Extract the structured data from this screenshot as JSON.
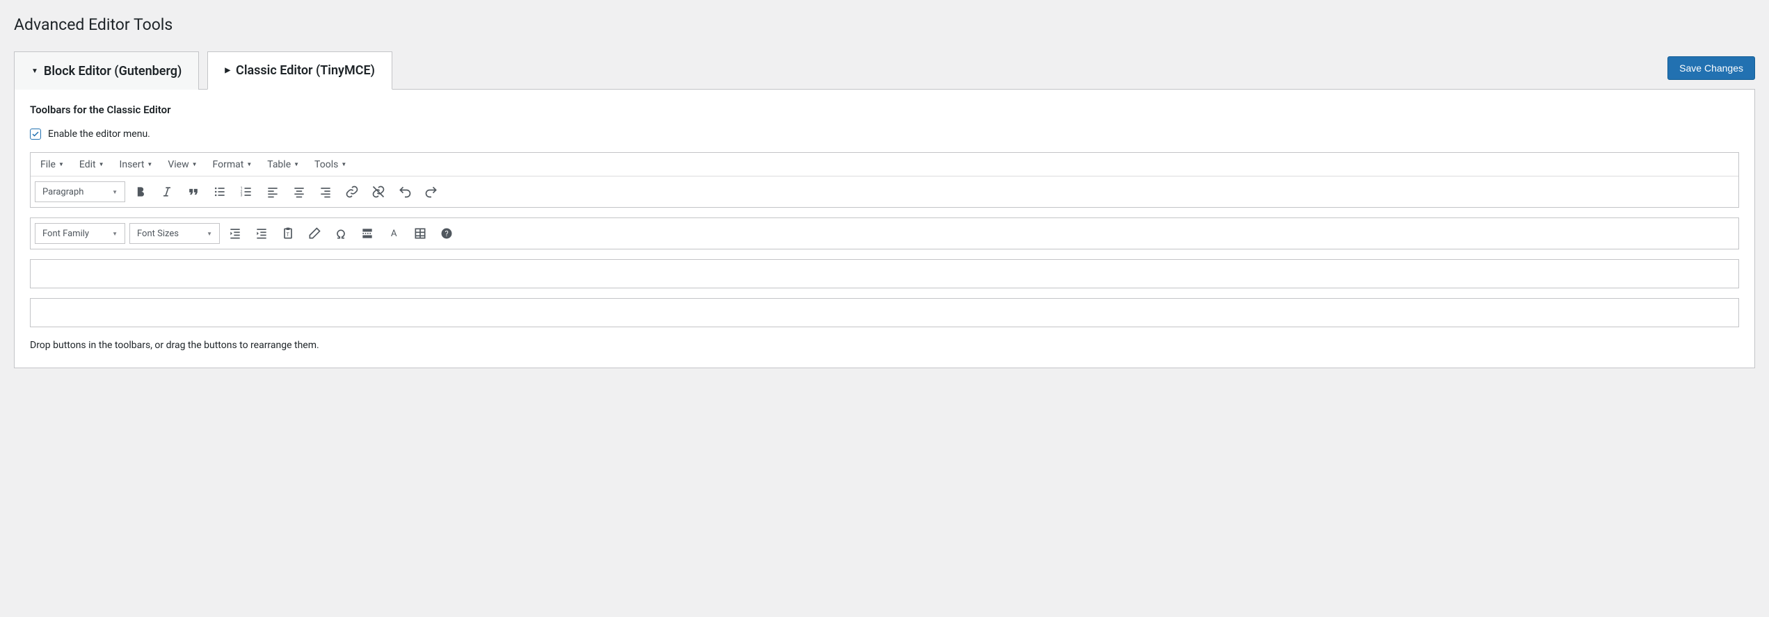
{
  "page": {
    "title": "Advanced Editor Tools",
    "save_button": "Save Changes"
  },
  "tabs": {
    "block": "Block Editor (Gutenberg)",
    "classic": "Classic Editor (TinyMCE)"
  },
  "section": {
    "title": "Toolbars for the Classic Editor",
    "enable_menu": "Enable the editor menu.",
    "hint": "Drop buttons in the toolbars, or drag the buttons to rearrange them."
  },
  "menubar": {
    "file": "File",
    "edit": "Edit",
    "insert": "Insert",
    "view": "View",
    "format": "Format",
    "table": "Table",
    "tools": "Tools"
  },
  "row1": {
    "paragraph": "Paragraph"
  },
  "row2": {
    "font_family": "Font Family",
    "font_sizes": "Font Sizes"
  }
}
